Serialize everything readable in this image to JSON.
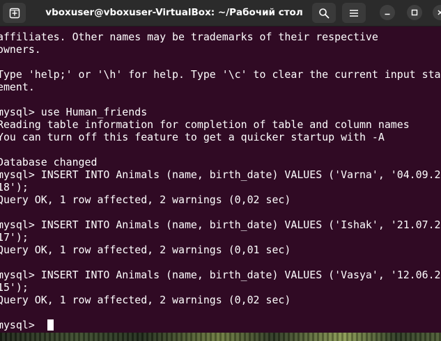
{
  "titlebar": {
    "title": "vboxuser@vboxuser-VirtualBox: ~/Рабочий стол",
    "new_tab_icon": "new-tab-icon",
    "search_icon": "search-icon",
    "menu_icon": "hamburger-menu-icon",
    "minimize_icon": "minimize-icon",
    "maximize_icon": "maximize-icon",
    "close_icon": "close-icon"
  },
  "colors": {
    "terminal_background": "#300a24",
    "terminal_text": "#ffffff",
    "titlebar_background": "#2b2b2b"
  },
  "terminal": {
    "lines": [
      "affiliates. Other names may be trademarks of their respective",
      "owners.",
      "",
      "Type 'help;' or '\\h' for help. Type '\\c' to clear the current input sta",
      "ement.",
      "",
      "mysql> use Human_friends",
      "Reading table information for completion of table and column names",
      "You can turn off this feature to get a quicker startup with -A",
      "",
      "Database changed",
      "mysql> INSERT INTO Animals (name, birth_date) VALUES ('Varna', '04.09.2",
      "18');",
      "Query OK, 1 row affected, 2 warnings (0,02 sec)",
      "",
      "mysql> INSERT INTO Animals (name, birth_date) VALUES ('Ishak', '21.07.2",
      "17');",
      "Query OK, 1 row affected, 2 warnings (0,01 sec)",
      "",
      "mysql> INSERT INTO Animals (name, birth_date) VALUES ('Vasya', '12.06.2",
      "15');",
      "Query OK, 1 row affected, 2 warnings (0,02 sec)",
      "",
      "mysql> "
    ]
  }
}
